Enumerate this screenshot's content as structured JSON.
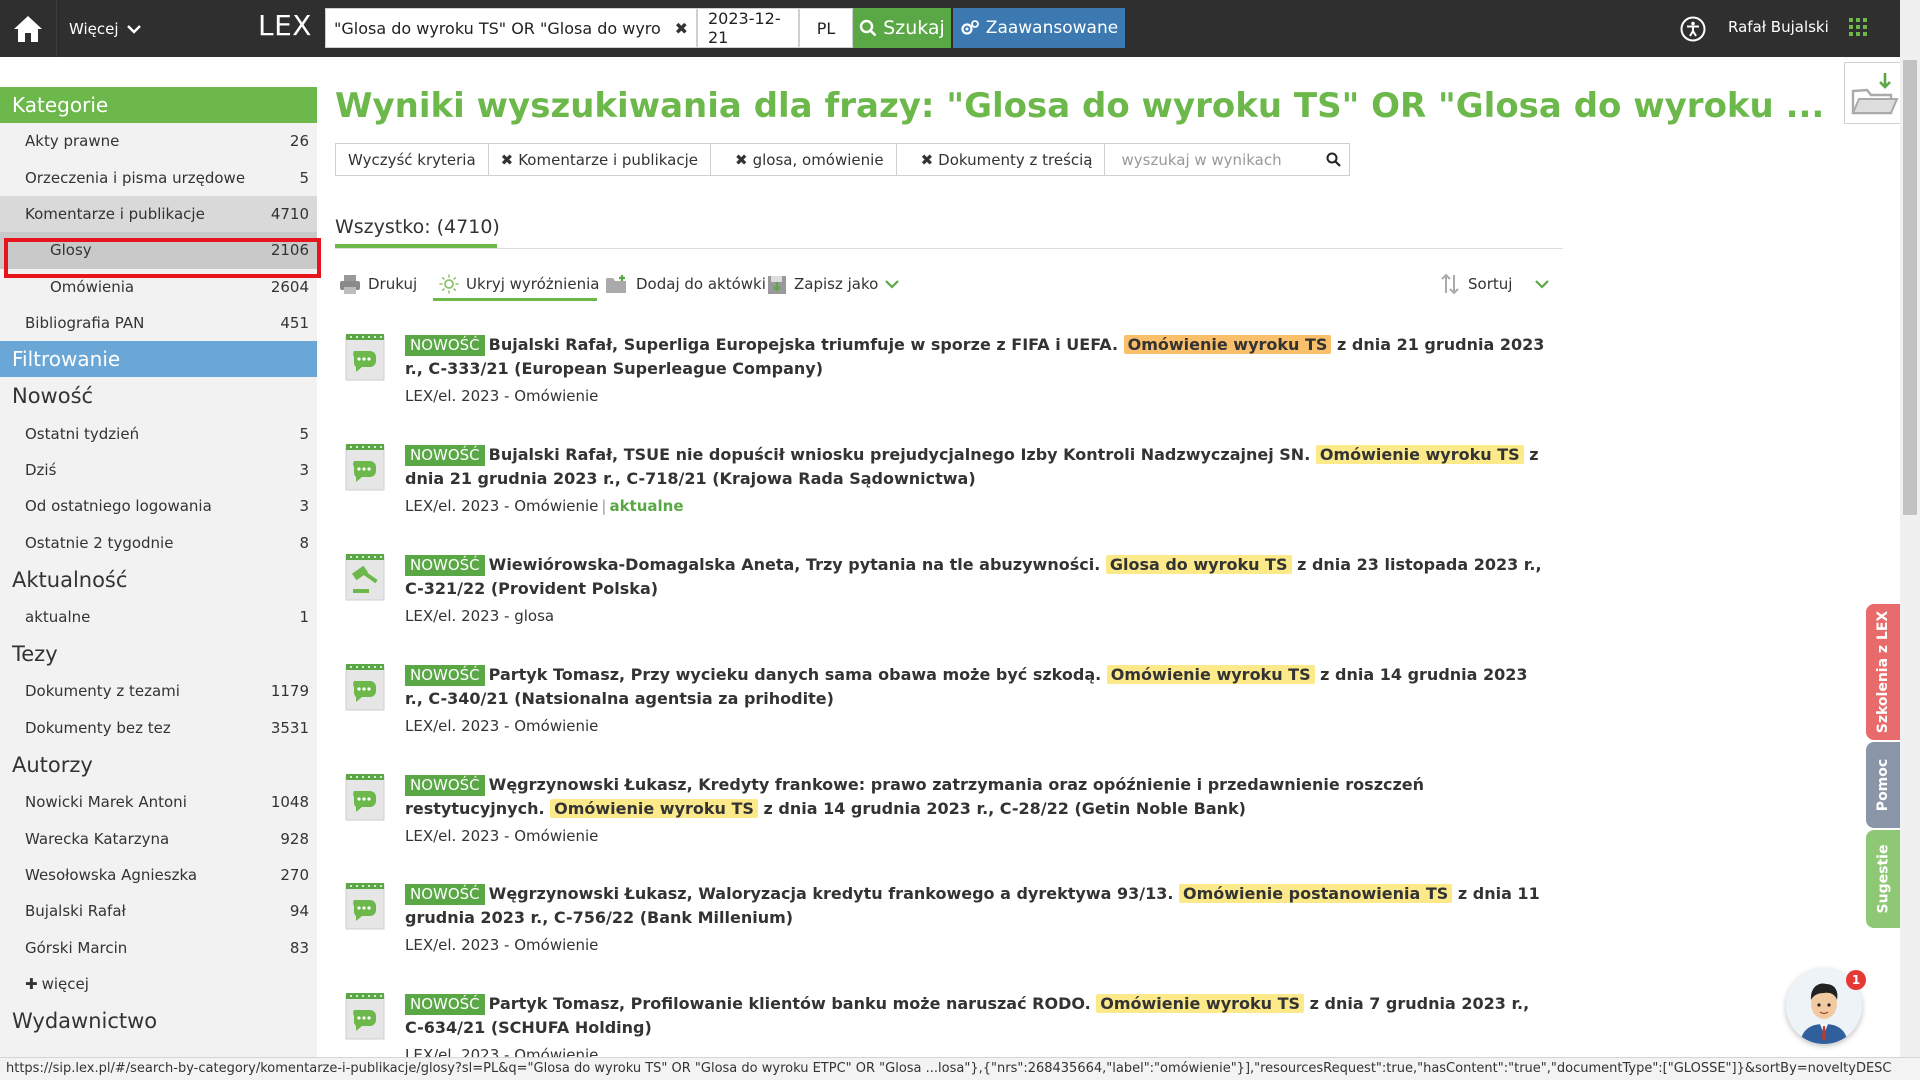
{
  "topbar": {
    "more_label": "Więcej",
    "brand": "LEX",
    "search_value": "\"Glosa do wyroku TS\" OR \"Glosa do wyroku",
    "date_value": "2023-12-21",
    "lang_value": "PL",
    "search_button": "Szukaj",
    "advanced_button": "Zaawansowane",
    "user_name": "Rafał Bujalski",
    "colors": {
      "bar": "#2f2f2f",
      "search_btn": "#5aa845",
      "adv_btn": "#3b79b0"
    }
  },
  "sidebar": {
    "categories_header": "Kategorie",
    "categories": [
      {
        "label": "Akty prawne",
        "count": "26"
      },
      {
        "label": "Orzeczenia i pisma urzędowe",
        "count": "5"
      },
      {
        "label": "Komentarze i publikacje",
        "count": "4710"
      },
      {
        "label": "Glosy",
        "count": "2106"
      },
      {
        "label": "Omówienia",
        "count": "2604"
      },
      {
        "label": "Bibliografia PAN",
        "count": "451"
      }
    ],
    "filter_header": "Filtrowanie",
    "groups": {
      "novelty": {
        "title": "Nowość",
        "items": [
          {
            "label": "Ostatni tydzień",
            "count": "5"
          },
          {
            "label": "Dziś",
            "count": "3"
          },
          {
            "label": "Od ostatniego logowania",
            "count": "3"
          },
          {
            "label": "Ostatnie 2 tygodnie",
            "count": "8"
          }
        ]
      },
      "actuality": {
        "title": "Aktualność",
        "items": [
          {
            "label": "aktualne",
            "count": "1"
          }
        ]
      },
      "theses": {
        "title": "Tezy",
        "items": [
          {
            "label": "Dokumenty z tezami",
            "count": "1179"
          },
          {
            "label": "Dokumenty bez tez",
            "count": "3531"
          }
        ]
      },
      "authors": {
        "title": "Autorzy",
        "items": [
          {
            "label": "Nowicki Marek Antoni",
            "count": "1048"
          },
          {
            "label": "Warecka Katarzyna",
            "count": "928"
          },
          {
            "label": "Wesołowska Agnieszka",
            "count": "270"
          },
          {
            "label": "Bujalski Rafał",
            "count": "94"
          },
          {
            "label": "Górski Marcin",
            "count": "83"
          }
        ],
        "more": "więcej"
      },
      "publisher": {
        "title": "Wydawnictwo"
      }
    }
  },
  "main": {
    "title": "Wyniki wyszukiwania dla frazy: \"Glosa do wyroku TS\" OR \"Glosa do wyroku ...",
    "filters": {
      "clear": "Wyczyść kryteria",
      "chips": [
        "Komentarze i publikacje",
        "glosa, omówienie",
        "Dokumenty z treścią"
      ],
      "search_placeholder": "wyszukaj w wynikach"
    },
    "all_label": "Wszystko: (4710)",
    "toolbar": {
      "print": "Drukuj",
      "hide_highlights": "Ukryj wyróżnienia",
      "add_to_folder": "Dodaj do aktówki",
      "save_as": "Zapisz jako",
      "sort": "Sortuj"
    },
    "badge_label": "NOWOŚĆ",
    "results": [
      {
        "icon": "comment-doc-icon",
        "before": "Bujalski Rafał, Superliga Europejska triumfuje w sporze z FIFA i UEFA.",
        "highlight": "Omówienie wyroku TS",
        "highlight_color": "orange",
        "after": "z dnia 21 grudnia 2023 r.,",
        "line2": "C-333/21 (European Superleague Company)",
        "meta": "LEX/el. 2023 - Omówienie",
        "status": ""
      },
      {
        "icon": "comment-doc-icon",
        "before": "Bujalski Rafał, TSUE nie dopuścił wniosku prejudycjalnego Izby Kontroli Nadzwyczajnej SN.",
        "highlight": "Omówienie wyroku TS",
        "highlight_color": "yellow",
        "after": "z dnia 21",
        "line2": "grudnia 2023 r., C-718/21 (Krajowa Rada Sądownictwa)",
        "meta": "LEX/el. 2023 - Omówienie",
        "status": "aktualne"
      },
      {
        "icon": "gavel-doc-icon",
        "before": "Wiewiórowska-Domagalska Aneta, Trzy pytania na tle abuzywności.",
        "highlight": "Glosa do wyroku TS",
        "highlight_color": "yellow",
        "after": "z dnia 23 listopada 2023 r., C-321/22",
        "line2": "(Provident Polska)",
        "meta": "LEX/el. 2023 - glosa",
        "status": ""
      },
      {
        "icon": "comment-doc-icon",
        "before": "Partyk Tomasz, Przy wycieku danych sama obawa może być szkodą.",
        "highlight": "Omówienie wyroku TS",
        "highlight_color": "yellow",
        "after": "z dnia 14 grudnia 2023 r.,",
        "line2": "C-340/21 (Natsionalna agentsia za prihodite)",
        "meta": "LEX/el. 2023 - Omówienie",
        "status": ""
      },
      {
        "icon": "comment-doc-icon",
        "before": "Węgrzynowski Łukasz, Kredyty frankowe: prawo zatrzymania oraz opóźnienie i przedawnienie roszczeń restytucyjnych.",
        "highlight": "Omówienie wyroku TS",
        "highlight_color": "yellow",
        "after": "z dnia 14 grudnia 2023 r., C-28/22 (Getin Noble Bank)",
        "line2": "",
        "meta": "LEX/el. 2023 - Omówienie",
        "status": ""
      },
      {
        "icon": "comment-doc-icon",
        "before": "Węgrzynowski Łukasz, Waloryzacja kredytu frankowego a dyrektywa 93/13.",
        "highlight": "Omówienie postanowienia TS",
        "highlight_color": "yellow",
        "after": "z dnia 11 grudnia",
        "line2": "2023 r., C-756/22 (Bank Millenium)",
        "meta": "LEX/el. 2023 - Omówienie",
        "status": ""
      },
      {
        "icon": "comment-doc-icon",
        "before": "Partyk Tomasz, Profilowanie klientów banku może naruszać RODO.",
        "highlight": "Omówienie wyroku TS",
        "highlight_color": "yellow",
        "after": "z dnia 7 grudnia 2023 r., C-634/21",
        "line2": "(SCHUFA Holding)",
        "meta": "LEX/el. 2023 - Omówienie",
        "status": ""
      }
    ]
  },
  "side_tabs": {
    "training": "Szkolenia z LEX",
    "help": "Pomoc",
    "suggestions": "Sugestie"
  },
  "assistant_badge": "1",
  "status_url": "https://sip.lex.pl/#/search-by-category/komentarze-i-publikacje/glosy?sl=PL&q=\"Glosa do wyroku TS\" OR \"Glosa do wyroku ETPC\" OR \"Glosa ...losa\"},{\"nrs\":268435664,\"label\":\"omówienie\"}],\"resourcesRequest\":true,\"hasContent\":\"true\",\"documentType\":[\"GLOSSE\"]}&sortBy=noveltyDESC"
}
